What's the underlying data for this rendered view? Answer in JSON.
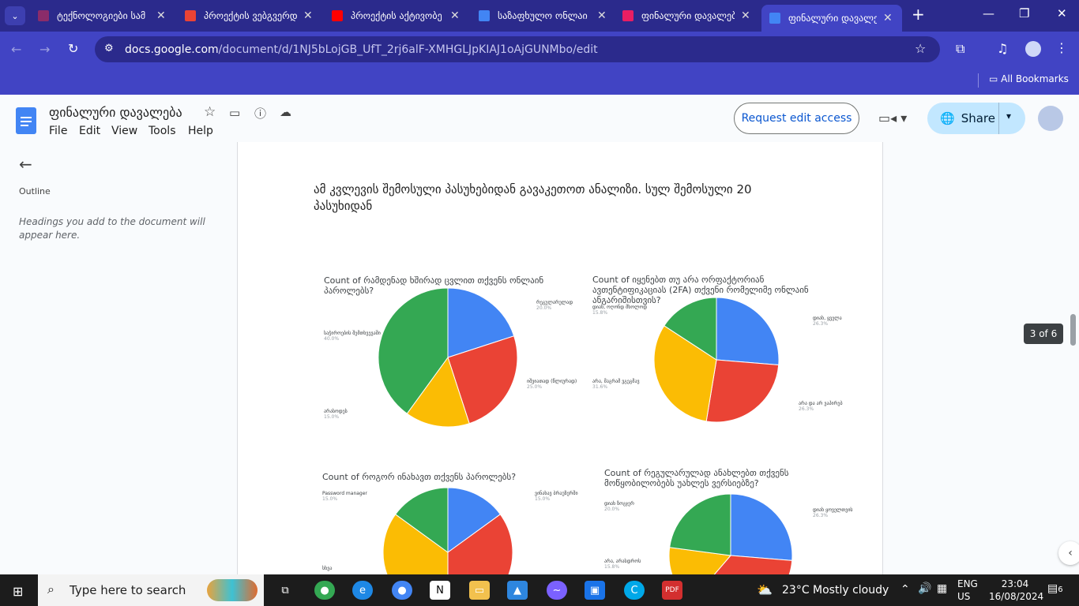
{
  "browser": {
    "tabs": [
      {
        "title": "ტექნოლოგიები სამ",
        "icon": "shield-icon",
        "color": "#8b2c6a"
      },
      {
        "title": "პროექტის ვებგვერდ",
        "icon": "gmail-icon",
        "color": "#ea4335"
      },
      {
        "title": "პროექტის აქტივობე",
        "icon": "youtube-icon",
        "color": "#ff0000"
      },
      {
        "title": "საზაფხულო ონლაი",
        "icon": "docs-icon",
        "color": "#4285f4"
      },
      {
        "title": "ფინალური დავალებ",
        "icon": "slides-icon",
        "color": "#e91e63"
      },
      {
        "title": "ფინალური დავალებ",
        "icon": "docs-icon",
        "color": "#4285f4"
      }
    ],
    "new_tab": "+",
    "url_host": "docs.google.com",
    "url_path": "/document/d/1NJ5bLojGB_UfT_2rj6alF-XMHGLJpKIAJ1oAjGUNMbo/edit",
    "bookmarks_label": "All Bookmarks"
  },
  "docs": {
    "title": "ფინალური დავალება",
    "menu": [
      "File",
      "Edit",
      "View",
      "Tools",
      "Help"
    ],
    "request_edit": "Request edit access",
    "share": "Share",
    "outline_title": "Outline",
    "outline_hint": "Headings you add to the document will appear here.",
    "page_indicator": "3 of 6",
    "body_text": "ამ კვლევის შემოსული პასუხებიდან გავაკეთოთ ანალიზი. სულ შემოსული 20 პასუხიდან"
  },
  "charts": [
    {
      "title": "Count of  რამდენად ხშირად ცვლით თქვენს ონლაინ პაროლებს?",
      "slices": [
        {
          "label": "რეგულარულად",
          "pct": "20.0%",
          "value": 20,
          "color": "#4285f4"
        },
        {
          "label": "იშვიათად (წლიურად)",
          "pct": "25.0%",
          "value": 25,
          "color": "#ea4335"
        },
        {
          "label": "არასოდეს",
          "pct": "15.0%",
          "value": 15,
          "color": "#fbbc04"
        },
        {
          "label": "საჭიროების შემთხვევაში",
          "pct": "40.0%",
          "value": 40,
          "color": "#34a853"
        }
      ]
    },
    {
      "title": "Count of იყენებთ თუ არა ორფაქტორიან ავთენტიფიკაციას (2FA) თქვენი რომელიმე ონლაინ ანგარიშისთვის?",
      "slices": [
        {
          "label": "დიახ, ყველა",
          "pct": "26.3%",
          "value": 26.3,
          "color": "#4285f4"
        },
        {
          "label": "არა და არ ვაპირებ",
          "pct": "26.3%",
          "value": 26.3,
          "color": "#ea4335"
        },
        {
          "label": "არა, მაგრამ ვგეგმავ",
          "pct": "31.6%",
          "value": 31.6,
          "color": "#fbbc04"
        },
        {
          "label": "დიახ, ოღონდ მხოლოდ",
          "pct": "15.8%",
          "value": 15.8,
          "color": "#34a853"
        }
      ]
    },
    {
      "title": "Count of როგორ ინახავთ თქვენს პაროლებს?",
      "slices": [
        {
          "label": "ვინახავ ბრაუზერში",
          "pct": "15.0%",
          "value": 15,
          "color": "#4285f4"
        },
        {
          "label": "",
          "pct": "",
          "value": 35,
          "color": "#ea4335"
        },
        {
          "label": "სხვა",
          "pct": "",
          "value": 35,
          "color": "#fbbc04"
        },
        {
          "label": "Password manager",
          "pct": "15.0%",
          "value": 15,
          "color": "#34a853"
        }
      ]
    },
    {
      "title": "Count of რეგულარულად ანახლებთ თქვენს მოწყობილობებს უახლეს ვერსიებზე?",
      "slices": [
        {
          "label": "დიახ ყოველთვის",
          "pct": "26.3%",
          "value": 26.3,
          "color": "#4285f4"
        },
        {
          "label": "",
          "pct": "",
          "value": 35,
          "color": "#ea4335"
        },
        {
          "label": "არა, არასდროს",
          "pct": "15.8%",
          "value": 15.8,
          "color": "#fbbc04"
        },
        {
          "label": "დიახ ზოგჯერ",
          "pct": "20.0%",
          "value": 22.9,
          "color": "#34a853"
        }
      ]
    }
  ],
  "taskbar": {
    "search_placeholder": "Type here to search",
    "weather": "23°C  Mostly cloudy",
    "lang": "ENG",
    "region": "US",
    "time": "23:04",
    "date": "16/08/2024",
    "notifications": "6"
  }
}
